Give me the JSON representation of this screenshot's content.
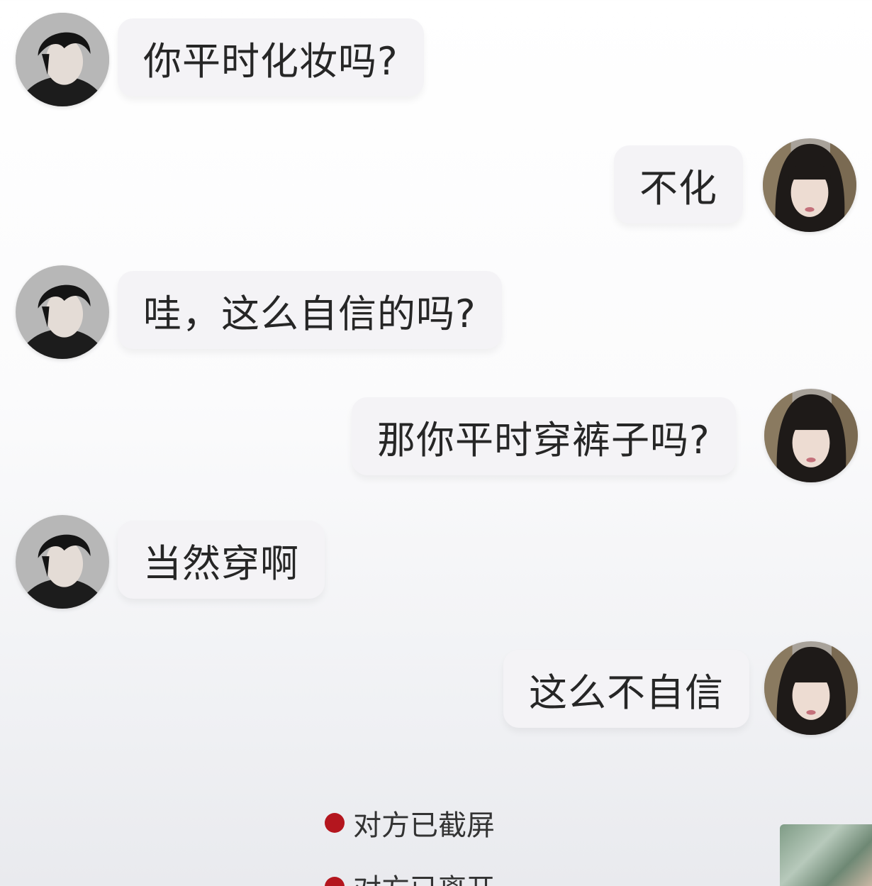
{
  "messages": [
    {
      "side": "left",
      "avatar": "male-avatar",
      "text": "你平时化妆吗?"
    },
    {
      "side": "right",
      "avatar": "female-avatar",
      "text": "不化"
    },
    {
      "side": "left",
      "avatar": "male-avatar",
      "text": "哇，这么自信的吗?"
    },
    {
      "side": "right",
      "avatar": "female-avatar",
      "text": "那你平时穿裤子吗?"
    },
    {
      "side": "left",
      "avatar": "male-avatar",
      "text": "当然穿啊"
    },
    {
      "side": "right",
      "avatar": "female-avatar",
      "text": "这么不自信"
    }
  ],
  "notices": [
    {
      "text": "对方已截屏"
    },
    {
      "text": "对方已离开"
    }
  ],
  "colors": {
    "bubble": "#f4f3f6",
    "text": "#262626",
    "notice_dot": "#b4161e"
  }
}
